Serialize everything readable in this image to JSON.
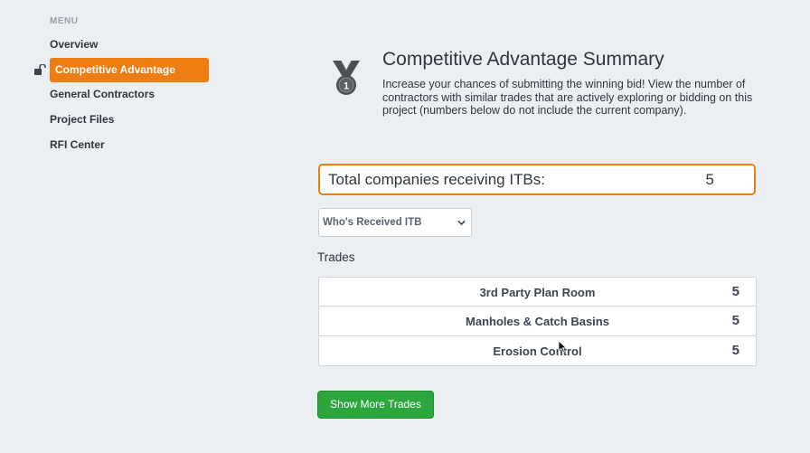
{
  "sidebar": {
    "menu_label": "MENU",
    "items": [
      {
        "label": "Overview"
      },
      {
        "label": "Competitive Advantage",
        "active": true
      },
      {
        "label": "General Contractors"
      },
      {
        "label": "Project Files"
      },
      {
        "label": "RFI Center"
      }
    ]
  },
  "header": {
    "icon": "medal-icon",
    "title": "Competitive Advantage Summary",
    "description": "Increase your chances of submitting the winning bid! View the number of contractors with similar trades that are actively exploring or bidding on this project (numbers below do not include the current company)."
  },
  "total": {
    "label": "Total companies receiving ITBs:",
    "value": "5"
  },
  "filter": {
    "selected": "Who's Received ITB"
  },
  "trades": {
    "label": "Trades",
    "rows": [
      {
        "name": "3rd Party Plan Room",
        "count": "5"
      },
      {
        "name": "Manholes & Catch Basins",
        "count": "5"
      },
      {
        "name": "Erosion Control",
        "count": "5"
      }
    ]
  },
  "actions": {
    "show_more": "Show More Trades"
  },
  "colors": {
    "accent": "#ee7d12",
    "button_green": "#2da63d",
    "background": "#ebeff2"
  }
}
